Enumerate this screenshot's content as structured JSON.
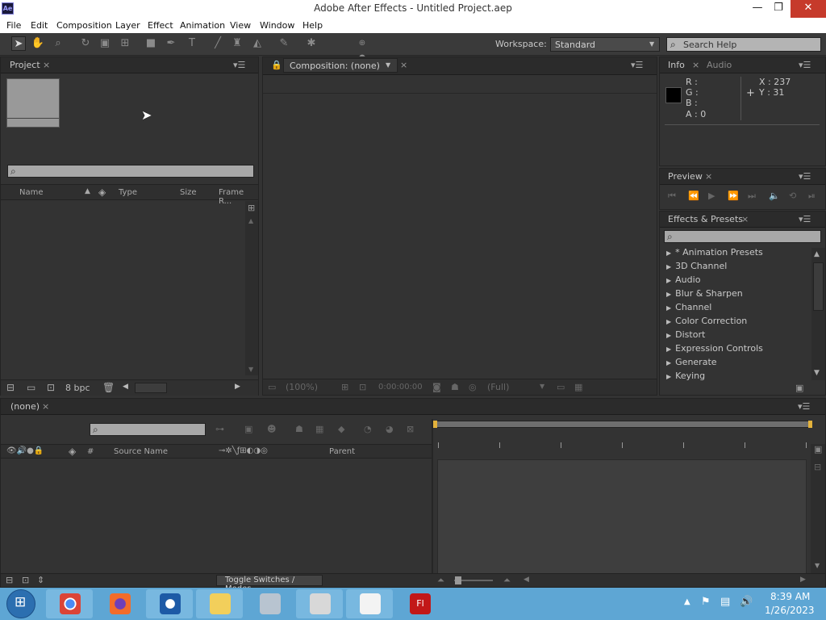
{
  "window": {
    "title": "Adobe After Effects - Untitled Project.aep",
    "logo": "Ae",
    "minimize": "—",
    "restore": "❐",
    "close": "✕"
  },
  "menu": [
    "File",
    "Edit",
    "Composition",
    "Layer",
    "Effect",
    "Animation",
    "View",
    "Window",
    "Help"
  ],
  "toolbar": {
    "workspace_label": "Workspace:",
    "workspace_value": "Standard",
    "search_placeholder": "Search Help"
  },
  "project": {
    "tab": "Project",
    "columns": [
      "Name",
      "Type",
      "Size",
      "Frame R..."
    ],
    "bpc": "8 bpc"
  },
  "composition": {
    "tab": "Composition: (none)",
    "zoom": "(100%)",
    "timecode": "0:00:00:00",
    "resolution": "(Full)"
  },
  "info": {
    "tab": "Info",
    "tab2": "Audio",
    "r": "R :",
    "g": "G :",
    "b": "B :",
    "a": "A : 0",
    "x": "X : 237",
    "y": "Y : 31"
  },
  "preview": {
    "tab": "Preview"
  },
  "effects": {
    "tab": "Effects & Presets",
    "items": [
      "* Animation Presets",
      "3D Channel",
      "Audio",
      "Blur & Sharpen",
      "Channel",
      "Color Correction",
      "Distort",
      "Expression Controls",
      "Generate",
      "Keying"
    ]
  },
  "timeline": {
    "tab": "(none)",
    "col_hash": "#",
    "col_source": "Source Name",
    "col_parent": "Parent",
    "toggle": "Toggle Switches / Modes"
  },
  "taskbar": {
    "time": "8:39 AM",
    "date": "1/26/2023",
    "apps": [
      "chrome",
      "firefox",
      "obama-campaign",
      "file-explorer",
      "archive",
      "store",
      "document",
      "flash"
    ]
  },
  "colors": {
    "chrome_bg": "#333333",
    "titlebar": "#ffffff",
    "close_red": "#c63a2b",
    "taskbar": "#5ea6d4"
  }
}
